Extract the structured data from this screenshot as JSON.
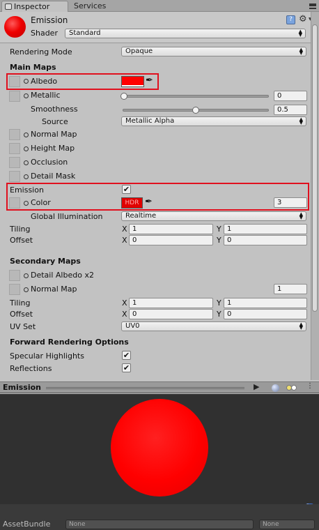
{
  "tabs": {
    "inspector": "Inspector",
    "services": "Services"
  },
  "header": {
    "title": "Emission",
    "shader_label": "Shader",
    "shader_value": "Standard",
    "help_icon": "?"
  },
  "rendering_mode": {
    "label": "Rendering Mode",
    "value": "Opaque"
  },
  "main_maps": {
    "title": "Main Maps",
    "albedo": "Albedo",
    "metallic": "Metallic",
    "metallic_value": "0",
    "smoothness": "Smoothness",
    "smoothness_value": "0.5",
    "smoothness_level": 0.5,
    "source_label": "Source",
    "source_value": "Metallic Alpha",
    "normal_map": "Normal Map",
    "height_map": "Height Map",
    "occlusion": "Occlusion",
    "detail_mask": "Detail Mask",
    "emission": "Emission",
    "emission_checked": true,
    "color": "Color",
    "hdr": "HDR",
    "emission_intensity": "3",
    "gi_label": "Global Illumination",
    "gi_value": "Realtime",
    "tiling": "Tiling",
    "offset": "Offset",
    "tiling_x": "1",
    "tiling_y": "1",
    "offset_x": "0",
    "offset_y": "0"
  },
  "secondary_maps": {
    "title": "Secondary Maps",
    "detail_albedo": "Detail Albedo x2",
    "normal_map": "Normal Map",
    "normal_value": "1",
    "tiling": "Tiling",
    "offset": "Offset",
    "tiling_x": "1",
    "tiling_y": "1",
    "offset_x": "0",
    "offset_y": "0",
    "uv_set_label": "UV Set",
    "uv_set_value": "UV0"
  },
  "forward": {
    "title": "Forward Rendering Options",
    "specular": "Specular Highlights",
    "reflections": "Reflections"
  },
  "axis": {
    "x": "X",
    "y": "Y"
  },
  "preview": {
    "title": "Emission"
  },
  "bottom": {
    "label": "AssetBundle",
    "bundle_value": "None",
    "variant_value": "None"
  },
  "colors": {
    "accent": "#ff0000",
    "highlight": "#e0101e"
  }
}
